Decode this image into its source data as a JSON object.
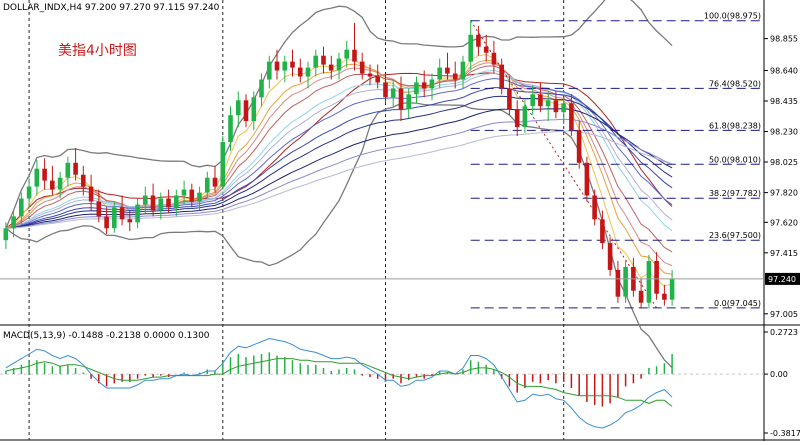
{
  "header": {
    "symbol_line": "DOLLAR_INDX,H4  97.200 97.270 97.115 97.240",
    "annotation": "美指4小时图"
  },
  "chart_data": [
    {
      "type": "candlestick",
      "title": "",
      "ylim": [
        96.95,
        99.02
      ],
      "y_ticks": [
        "98.855",
        "98.640",
        "98.435",
        "98.230",
        "98.025",
        "97.820",
        "97.620",
        "97.415",
        "97.005"
      ],
      "current_price_label": "97.240",
      "candles_ohlc": [
        [
          97.5,
          97.62,
          97.44,
          97.58
        ],
        [
          97.58,
          97.7,
          97.52,
          97.66
        ],
        [
          97.66,
          97.82,
          97.6,
          97.78
        ],
        [
          97.78,
          97.92,
          97.72,
          97.86
        ],
        [
          97.86,
          98.04,
          97.8,
          97.98
        ],
        [
          97.98,
          98.05,
          97.84,
          97.9
        ],
        [
          97.9,
          98.0,
          97.8,
          97.84
        ],
        [
          97.84,
          97.96,
          97.78,
          97.92
        ],
        [
          97.92,
          98.06,
          97.86,
          98.02
        ],
        [
          98.02,
          98.12,
          97.9,
          97.94
        ],
        [
          97.94,
          98.0,
          97.8,
          97.86
        ],
        [
          97.86,
          97.94,
          97.7,
          97.76
        ],
        [
          97.76,
          97.84,
          97.62,
          97.66
        ],
        [
          97.66,
          97.72,
          97.54,
          97.58
        ],
        [
          97.58,
          97.76,
          97.55,
          97.72
        ],
        [
          97.72,
          97.8,
          97.6,
          97.64
        ],
        [
          97.64,
          97.7,
          97.56,
          97.62
        ],
        [
          97.62,
          97.78,
          97.58,
          97.74
        ],
        [
          97.74,
          97.86,
          97.68,
          97.8
        ],
        [
          97.8,
          97.88,
          97.66,
          97.7
        ],
        [
          97.7,
          97.82,
          97.64,
          97.78
        ],
        [
          97.78,
          97.84,
          97.68,
          97.72
        ],
        [
          97.72,
          97.84,
          97.66,
          97.8
        ],
        [
          97.8,
          97.9,
          97.74,
          97.84
        ],
        [
          97.84,
          97.88,
          97.72,
          97.76
        ],
        [
          97.76,
          97.86,
          97.7,
          97.82
        ],
        [
          97.82,
          97.96,
          97.78,
          97.92
        ],
        [
          97.92,
          98.0,
          97.82,
          97.86
        ],
        [
          97.86,
          98.2,
          97.84,
          98.16
        ],
        [
          98.16,
          98.4,
          98.1,
          98.34
        ],
        [
          98.34,
          98.5,
          98.26,
          98.44
        ],
        [
          98.44,
          98.48,
          98.26,
          98.3
        ],
        [
          98.3,
          98.5,
          98.24,
          98.46
        ],
        [
          98.46,
          98.62,
          98.4,
          98.58
        ],
        [
          98.58,
          98.74,
          98.52,
          98.7
        ],
        [
          98.7,
          98.78,
          98.58,
          98.64
        ],
        [
          98.64,
          98.74,
          98.56,
          98.7
        ],
        [
          98.7,
          98.78,
          98.6,
          98.66
        ],
        [
          98.66,
          98.72,
          98.56,
          98.6
        ],
        [
          98.6,
          98.7,
          98.52,
          98.66
        ],
        [
          98.66,
          98.78,
          98.6,
          98.74
        ],
        [
          98.74,
          98.8,
          98.62,
          98.68
        ],
        [
          98.68,
          98.74,
          98.58,
          98.64
        ],
        [
          98.64,
          98.76,
          98.58,
          98.72
        ],
        [
          98.72,
          98.84,
          98.66,
          98.78
        ],
        [
          98.78,
          98.96,
          98.64,
          98.7
        ],
        [
          98.7,
          98.76,
          98.58,
          98.62
        ],
        [
          98.62,
          98.68,
          98.54,
          98.6
        ],
        [
          98.6,
          98.68,
          98.52,
          98.56
        ],
        [
          98.56,
          98.62,
          98.42,
          98.46
        ],
        [
          98.46,
          98.58,
          98.4,
          98.52
        ],
        [
          98.52,
          98.6,
          98.3,
          98.38
        ],
        [
          98.38,
          98.52,
          98.32,
          98.48
        ],
        [
          98.48,
          98.6,
          98.42,
          98.56
        ],
        [
          98.56,
          98.64,
          98.46,
          98.52
        ],
        [
          98.52,
          98.62,
          98.44,
          98.58
        ],
        [
          98.58,
          98.72,
          98.52,
          98.66
        ],
        [
          98.66,
          98.76,
          98.58,
          98.62
        ],
        [
          98.62,
          98.7,
          98.52,
          98.58
        ],
        [
          98.58,
          98.74,
          98.52,
          98.7
        ],
        [
          98.7,
          98.98,
          98.64,
          98.88
        ],
        [
          98.88,
          98.94,
          98.74,
          98.8
        ],
        [
          98.8,
          98.88,
          98.7,
          98.76
        ],
        [
          98.76,
          98.84,
          98.62,
          98.68
        ],
        [
          98.68,
          98.72,
          98.48,
          98.52
        ],
        [
          98.52,
          98.6,
          98.34,
          98.38
        ],
        [
          98.38,
          98.44,
          98.2,
          98.26
        ],
        [
          98.26,
          98.44,
          98.22,
          98.4
        ],
        [
          98.4,
          98.54,
          98.34,
          98.48
        ],
        [
          98.48,
          98.56,
          98.36,
          98.4
        ],
        [
          98.4,
          98.5,
          98.3,
          98.44
        ],
        [
          98.44,
          98.5,
          98.32,
          98.36
        ],
        [
          98.36,
          98.46,
          98.28,
          98.42
        ],
        [
          98.42,
          98.48,
          98.2,
          98.24
        ],
        [
          98.24,
          98.3,
          97.98,
          98.02
        ],
        [
          98.02,
          98.06,
          97.76,
          97.8
        ],
        [
          97.8,
          97.84,
          97.6,
          97.64
        ],
        [
          97.64,
          97.7,
          97.44,
          97.48
        ],
        [
          97.48,
          97.52,
          97.26,
          97.3
        ],
        [
          97.3,
          97.36,
          97.08,
          97.12
        ],
        [
          97.12,
          97.36,
          97.08,
          97.32
        ],
        [
          97.32,
          97.38,
          97.12,
          97.16
        ],
        [
          97.16,
          97.24,
          97.04,
          97.08
        ],
        [
          97.08,
          97.4,
          97.04,
          97.36
        ],
        [
          97.36,
          97.42,
          97.1,
          97.14
        ],
        [
          97.14,
          97.2,
          97.06,
          97.1
        ],
        [
          97.1,
          97.3,
          97.06,
          97.24
        ]
      ],
      "fibonacci_levels": [
        {
          "label": "100.0(98.975)",
          "value": 98.975
        },
        {
          "label": "76.4(98.520)",
          "value": 98.52
        },
        {
          "label": "61.8(98.238)",
          "value": 98.238
        },
        {
          "label": "50.0(98.010)",
          "value": 98.01
        },
        {
          "label": "38.2(97.782)",
          "value": 97.782
        },
        {
          "label": "23.6(97.500)",
          "value": 97.5
        },
        {
          "label": "0.0(97.045)",
          "value": 97.045
        }
      ],
      "colors": {
        "up": "#21b34a",
        "down": "#c41616",
        "fib": "#1a1a8c",
        "bands": "#7a7a7a"
      }
    },
    {
      "type": "macd",
      "title": "MACD(5,13,9) -0.1488 -0.2138 0.0000 0.1300",
      "ylim": [
        -0.3817,
        0.2723
      ],
      "y_ticks": [
        "0.2723",
        "0.00",
        "-0.3817"
      ],
      "histogram": [
        0.02,
        0.04,
        0.06,
        0.08,
        0.09,
        0.07,
        0.05,
        0.05,
        0.06,
        0.04,
        0.01,
        -0.03,
        -0.06,
        -0.08,
        -0.06,
        -0.05,
        -0.05,
        -0.03,
        -0.01,
        -0.02,
        -0.01,
        -0.02,
        0.0,
        0.01,
        0.0,
        0.01,
        0.03,
        0.02,
        0.07,
        0.11,
        0.13,
        0.11,
        0.12,
        0.13,
        0.14,
        0.12,
        0.11,
        0.09,
        0.07,
        0.06,
        0.06,
        0.04,
        0.02,
        0.03,
        0.04,
        0.03,
        -0.01,
        -0.02,
        -0.03,
        -0.05,
        -0.03,
        -0.06,
        -0.04,
        -0.02,
        -0.03,
        -0.01,
        0.02,
        0.01,
        0.0,
        0.03,
        0.09,
        0.08,
        0.06,
        0.03,
        -0.03,
        -0.08,
        -0.12,
        -0.09,
        -0.05,
        -0.06,
        -0.04,
        -0.06,
        -0.05,
        -0.09,
        -0.14,
        -0.18,
        -0.2,
        -0.21,
        -0.19,
        -0.15,
        -0.08,
        -0.06,
        -0.03,
        0.04,
        0.05,
        0.07,
        0.13
      ],
      "macd_line": [
        0.04,
        0.07,
        0.1,
        0.13,
        0.16,
        0.15,
        0.12,
        0.1,
        0.12,
        0.1,
        0.06,
        0.0,
        -0.05,
        -0.09,
        -0.09,
        -0.09,
        -0.09,
        -0.07,
        -0.04,
        -0.04,
        -0.03,
        -0.03,
        -0.01,
        0.0,
        -0.01,
        0.0,
        0.02,
        0.02,
        0.07,
        0.14,
        0.18,
        0.17,
        0.19,
        0.21,
        0.23,
        0.22,
        0.21,
        0.19,
        0.16,
        0.15,
        0.14,
        0.12,
        0.1,
        0.1,
        0.11,
        0.1,
        0.06,
        0.03,
        0.0,
        -0.04,
        -0.04,
        -0.08,
        -0.07,
        -0.04,
        -0.04,
        -0.02,
        0.02,
        0.02,
        0.0,
        0.04,
        0.12,
        0.12,
        0.1,
        0.06,
        -0.02,
        -0.1,
        -0.18,
        -0.17,
        -0.13,
        -0.14,
        -0.13,
        -0.16,
        -0.17,
        -0.22,
        -0.28,
        -0.32,
        -0.34,
        -0.35,
        -0.33,
        -0.3,
        -0.25,
        -0.23,
        -0.2,
        -0.15,
        -0.12,
        -0.1,
        -0.15
      ],
      "signal_line": [
        0.02,
        0.03,
        0.04,
        0.05,
        0.07,
        0.08,
        0.07,
        0.05,
        0.06,
        0.06,
        0.05,
        0.03,
        0.01,
        -0.01,
        -0.03,
        -0.04,
        -0.04,
        -0.04,
        -0.03,
        -0.02,
        -0.02,
        -0.01,
        -0.01,
        -0.01,
        -0.01,
        -0.01,
        -0.01,
        0.0,
        0.0,
        0.03,
        0.05,
        0.06,
        0.07,
        0.08,
        0.09,
        0.1,
        0.1,
        0.1,
        0.09,
        0.09,
        0.08,
        0.08,
        0.08,
        0.07,
        0.07,
        0.07,
        0.07,
        0.05,
        0.03,
        0.01,
        -0.01,
        -0.02,
        -0.03,
        -0.02,
        -0.01,
        -0.01,
        0.0,
        0.01,
        0.0,
        0.01,
        0.03,
        0.04,
        0.04,
        0.03,
        0.01,
        -0.02,
        -0.06,
        -0.08,
        -0.08,
        -0.08,
        -0.09,
        -0.1,
        -0.12,
        -0.13,
        -0.14,
        -0.14,
        -0.14,
        -0.14,
        -0.14,
        -0.15,
        -0.17,
        -0.17,
        -0.17,
        -0.19,
        -0.17,
        -0.17,
        -0.21
      ],
      "colors": {
        "hist_up": "#21b34a",
        "hist_down": "#c41616",
        "macd": "#3a8fd8",
        "signal": "#2f9e2f"
      }
    }
  ]
}
